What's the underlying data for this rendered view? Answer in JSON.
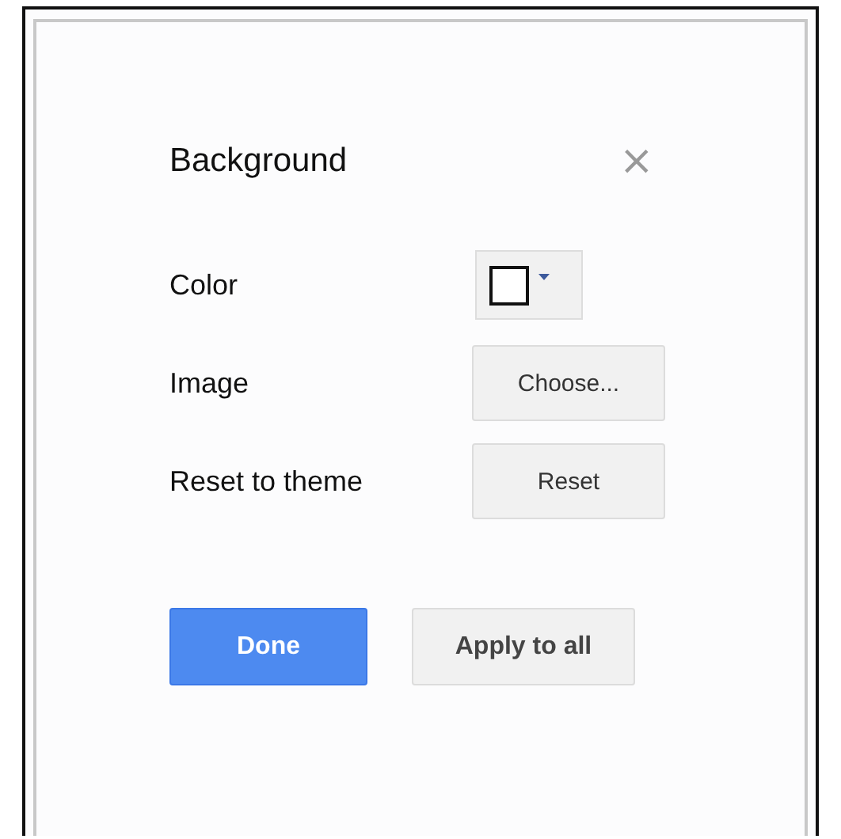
{
  "dialog": {
    "title": "Background",
    "close": "×"
  },
  "rows": [
    {
      "label": "Color",
      "kind": "swatch"
    },
    {
      "label": "Image",
      "kind": "button",
      "button": "Choose..."
    },
    {
      "label": "Reset to theme",
      "kind": "button",
      "button": "Reset"
    }
  ],
  "buttons": [
    {
      "label": "Done",
      "kind": "primary"
    },
    {
      "label": "Apply to all",
      "kind": "secondary"
    }
  ]
}
